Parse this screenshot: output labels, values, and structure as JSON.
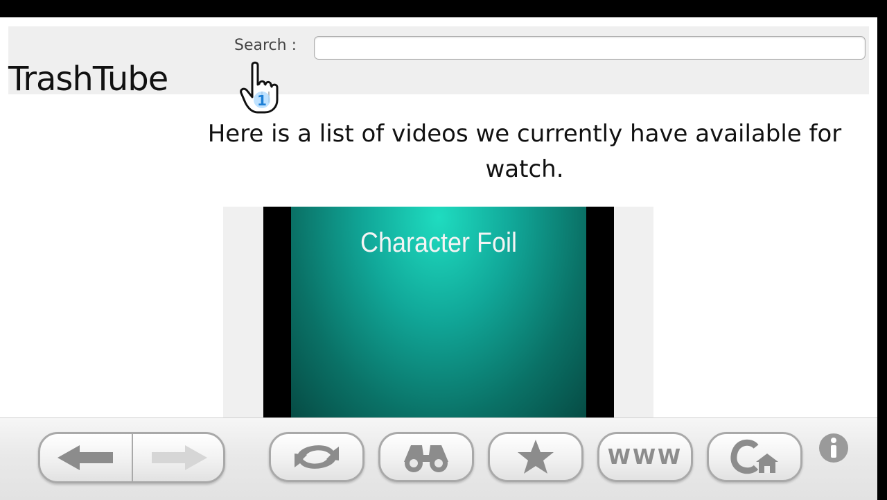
{
  "site": {
    "title": "TrashTube"
  },
  "search": {
    "label": "Search :",
    "value": "",
    "placeholder": ""
  },
  "main": {
    "intro_text": "Here is a list of videos we currently have available for watch."
  },
  "videos": [
    {
      "title": "Character Foil"
    }
  ],
  "cursor": {
    "player_number": "1"
  },
  "toolbar": {
    "buttons": [
      {
        "icon": "back-arrow-icon"
      },
      {
        "icon": "forward-arrow-icon",
        "disabled": true
      },
      {
        "icon": "refresh-icon"
      },
      {
        "icon": "binoculars-icon"
      },
      {
        "icon": "star-icon"
      },
      {
        "icon": "www-icon",
        "label": "WWW"
      },
      {
        "icon": "home-icon"
      },
      {
        "icon": "info-icon"
      }
    ],
    "www_label": "WWW"
  },
  "colors": {
    "video_gradient_light": "#1fdcc0",
    "video_gradient_dark": "#064a43",
    "button_icon_gray": "#8c8c8c"
  }
}
